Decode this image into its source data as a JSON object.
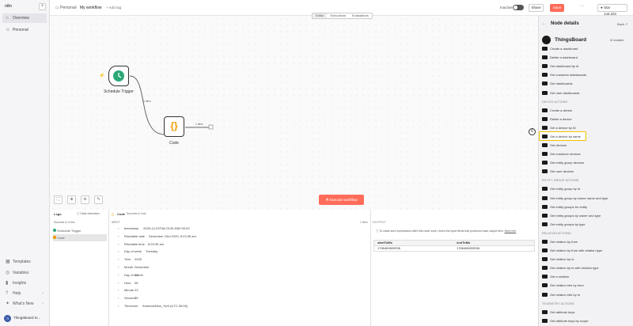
{
  "app": {
    "logo": "n8n",
    "user_initials": "TI",
    "user_name": "ThingsBoard In..."
  },
  "sidebar": {
    "items": [
      {
        "label": "Overview",
        "icon": "home-icon"
      },
      {
        "label": "Personal",
        "icon": "user-icon"
      }
    ],
    "bottom": [
      {
        "label": "Templates"
      },
      {
        "label": "Variables"
      },
      {
        "label": "Insights"
      },
      {
        "label": "Help"
      },
      {
        "label": "What's New"
      }
    ]
  },
  "topbar": {
    "crumb_personal": "Personal",
    "separator": "/",
    "workflow_name": "My workflow",
    "add_tag": "+ Add tag",
    "inactive_label": "Inactive",
    "share": "Share",
    "save": "Save",
    "more": "···",
    "star_label": "Star",
    "star_count": "144,331"
  },
  "tabs": [
    "Editor",
    "Executions",
    "Evaluations"
  ],
  "canvas": {
    "trigger_label": "Schedule Trigger",
    "code_label": "Code",
    "edge1_label": "1 item",
    "edge2_label": "1 item",
    "execute_button": "Execute workflow"
  },
  "logs": {
    "title": "Logs",
    "clear": "Clear execution",
    "success": "Success in 12ms",
    "entries": [
      "Schedule Trigger",
      "Code"
    ]
  },
  "code_panel": {
    "title": "Code",
    "subtitle": "Success in 1ms",
    "input_label": "INPUT",
    "items_label": "1 item",
    "fields": [
      {
        "key": "timestamp",
        "value": "2025-12-23T08:23:35.538+00:00"
      },
      {
        "key": "Readable date",
        "value": "December 23rd 2025, 8:23:35 am"
      },
      {
        "key": "Readable time",
        "value": "8:23:35 am"
      },
      {
        "key": "Day of week",
        "value": "Tuesday"
      },
      {
        "key": "Year",
        "value": "2025"
      },
      {
        "key": "Month",
        "value": "December"
      },
      {
        "key": "Day of month",
        "value": "23"
      },
      {
        "key": "Hour",
        "value": "08"
      },
      {
        "key": "Minute",
        "value": "23"
      },
      {
        "key": "Second",
        "value": "35"
      },
      {
        "key": "Timezone",
        "value": "America/New_York (UTC-05:00)"
      }
    ]
  },
  "output": {
    "title": "OUTPUT",
    "hint": "To make sure expressions after this node work, return the input items that produced each output item.",
    "more_info": "More info",
    "col1": "startToMs",
    "col2": "endToMs",
    "val1": "1766469600536",
    "val2": "1766466000536"
  },
  "right_panel": {
    "title": "Node details",
    "back": "Back",
    "node_name": "ThingsBoard",
    "installed": "Installed",
    "sections": [
      {
        "title": "",
        "items": [
          "Create a dashboard",
          "Delete a dashboard",
          "Get dashboard by id",
          "Get customer dashboards",
          "Get dashboards",
          "Get user dashboards"
        ]
      },
      {
        "title": "DEVICE ACTIONS",
        "items": [
          "Create a device",
          "Delete a device",
          "Get a device by ID",
          "Get a device by name",
          "Get devices",
          "Get customer devices",
          "Get entity group devices",
          "Get user devices"
        ]
      },
      {
        "title": "ENTITY GROUP ACTIONS",
        "items": [
          "Get entity group by id",
          "Get entity group by owner name and type",
          "Get entity groups for entity",
          "Get entity groups by owner and type",
          "Get entity groups by type"
        ]
      },
      {
        "title": "RELATION ACTIONS",
        "items": [
          "Get relation by from",
          "Get relation by from with relation type",
          "Get relation by to",
          "Get relation by to with relation type",
          "Get a relation",
          "Get relation info by from",
          "Get relation info by to"
        ]
      },
      {
        "title": "TELEMETRY ACTIONS",
        "items": [
          "Get attribute keys",
          "Get attribute keys by scope"
        ]
      }
    ],
    "badge": "6"
  }
}
